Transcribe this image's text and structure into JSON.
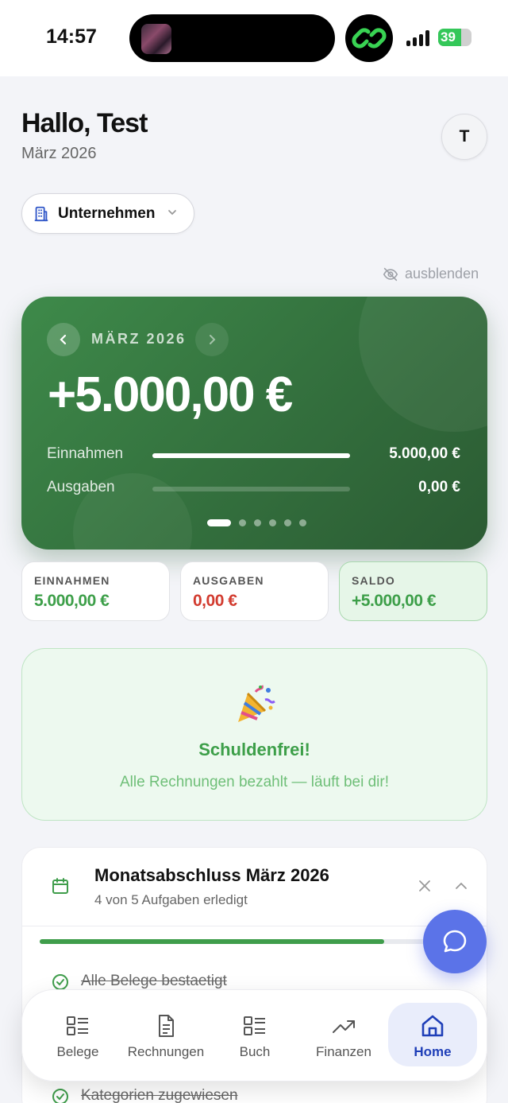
{
  "status_bar": {
    "time": "14:57",
    "battery": "39"
  },
  "header": {
    "greeting": "Hallo, Test",
    "date": "März 2026",
    "avatar_initial": "T"
  },
  "entity_switcher": {
    "label": "Unternehmen",
    "icon": "building-icon"
  },
  "hide_toggle": {
    "label": "ausblenden",
    "icon": "eye-off-icon"
  },
  "hero": {
    "month": "MÄRZ 2026",
    "balance": "+5.000,00 €",
    "rows": [
      {
        "label": "Einnahmen",
        "value": "5.000,00 €",
        "fill": 1.0
      },
      {
        "label": "Ausgaben",
        "value": "0,00 €",
        "fill": 0.0
      }
    ],
    "pages": 6,
    "active_page": 0
  },
  "summary": [
    {
      "label": "EINNAHMEN",
      "value": "5.000,00 €",
      "color": "#3d9f49"
    },
    {
      "label": "AUSGABEN",
      "value": "0,00 €",
      "color": "#d23b2f"
    },
    {
      "label": "SALDO",
      "value": "+5.000,00 €",
      "color": "#3d9f49"
    }
  ],
  "debt_free": {
    "icon": "party-popper-icon",
    "title": "Schuldenfrei!",
    "message": "Alle Rechnungen bezahlt — läuft bei dir!"
  },
  "closing": {
    "title": "Monatsabschluss März 2026",
    "subtitle": "4 von 5 Aufgaben erledigt",
    "progress": 0.8,
    "tasks": [
      {
        "label": "Alle Belege bestaetigt",
        "done": true
      },
      {
        "label": "Kategorien zugewiesen",
        "done": true
      }
    ]
  },
  "tabbar": {
    "tabs": [
      {
        "label": "Belege",
        "icon": "list-icon"
      },
      {
        "label": "Rechnungen",
        "icon": "document-icon"
      },
      {
        "label": "Buch",
        "icon": "list-icon"
      },
      {
        "label": "Finanzen",
        "icon": "trend-up-icon"
      },
      {
        "label": "Home",
        "icon": "home-icon",
        "active": true
      }
    ]
  },
  "colors": {
    "accent_green": "#3d9f49",
    "hero_green": "#336f3d",
    "danger": "#d23b2f",
    "nav_active": "#1f3fb8",
    "fab": "#5b73e8"
  }
}
